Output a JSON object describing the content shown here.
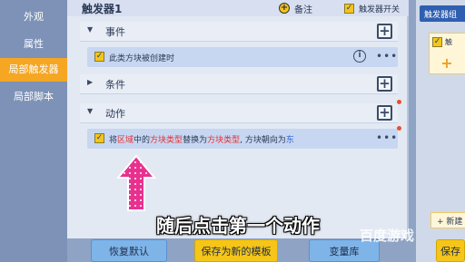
{
  "sidebar": {
    "items": [
      {
        "label": "外观"
      },
      {
        "label": "属性"
      },
      {
        "label": "局部触发器"
      },
      {
        "label": "局部脚本"
      }
    ]
  },
  "header": {
    "title": "触发器1",
    "note_label": "备注",
    "trigger_switch_label": "触发器开关"
  },
  "sections": {
    "event": {
      "label": "事件"
    },
    "condition": {
      "label": "条件"
    },
    "action": {
      "label": "动作"
    }
  },
  "event_row": {
    "text": "此类方块被创建时"
  },
  "action_row": {
    "parts": [
      "将",
      "区域",
      "中的",
      "方块类型",
      "替换为",
      "方块类型",
      ", 方块朝向为",
      "东"
    ]
  },
  "right_panel": {
    "header": "触发器组",
    "card_label": "触",
    "new_label": "+ 新建"
  },
  "bottom": {
    "restore_default": "恢复默认",
    "save_as_template": "保存为新的模板",
    "variable_library": "变量库",
    "save": "保存"
  },
  "overlay": {
    "subtitle": "随后点击第一个动作",
    "watermark": "百度游戏"
  },
  "colors": {
    "accent": "#f5a623",
    "highlight_red": "#e8302f",
    "highlight_blue": "#2f63d6",
    "pointer_pink": "#e8318f"
  },
  "icons": [
    "plus-icon",
    "info-icon",
    "more-icon",
    "note-icon",
    "chevron-down-icon",
    "chevron-right-icon",
    "checkbox-icon"
  ]
}
